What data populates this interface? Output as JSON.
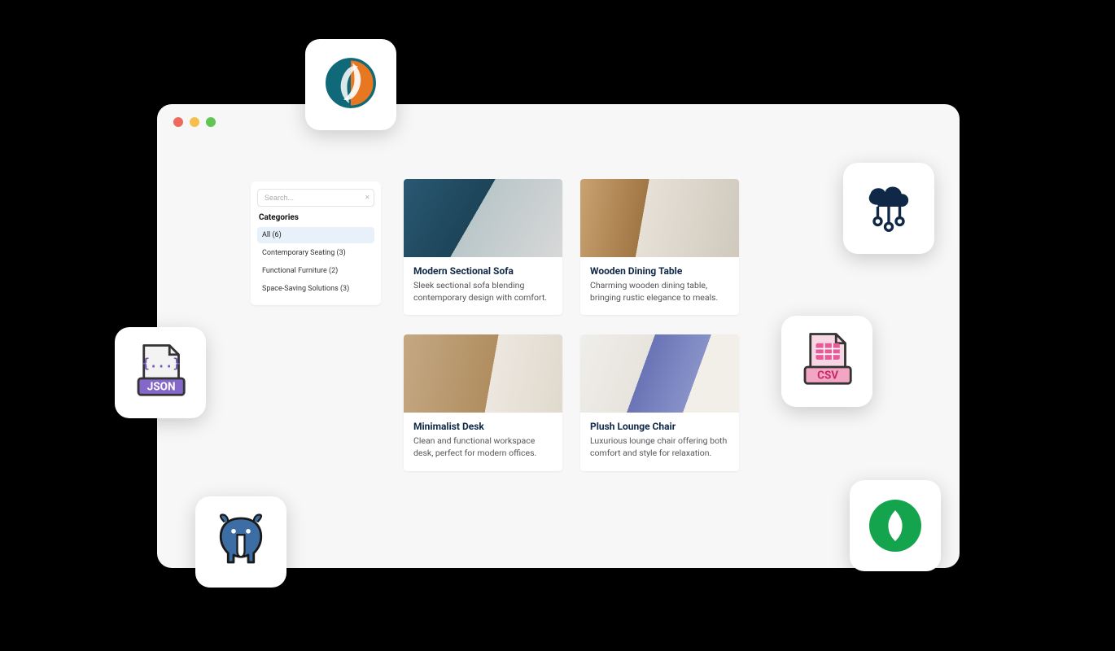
{
  "sidebar": {
    "search_placeholder": "Search...",
    "clear_icon": "×",
    "heading": "Categories",
    "items": [
      {
        "label": "All (6)",
        "active": true
      },
      {
        "label": "Contemporary Seating (3)",
        "active": false
      },
      {
        "label": "Functional Furniture (2)",
        "active": false
      },
      {
        "label": "Space-Saving Solutions (3)",
        "active": false
      }
    ]
  },
  "products": [
    {
      "title": "Modern Sectional Sofa",
      "desc": "Sleek sectional sofa blending contemporary design with comfort.",
      "img": "img-sofa"
    },
    {
      "title": "Wooden Dining Table",
      "desc": "Charming wooden dining table, bringing rustic elegance to meals.",
      "img": "img-table"
    },
    {
      "title": "Minimalist Desk",
      "desc": "Clean and functional workspace desk, perfect for modern offices.",
      "img": "img-desk"
    },
    {
      "title": "Plush Lounge Chair",
      "desc": "Luxurious lounge chair offering both comfort and style for relaxation.",
      "img": "img-chair"
    }
  ],
  "tiles": {
    "json_label": "JSON",
    "csv_label": "CSV"
  },
  "colors": {
    "window_bg": "#f7f7f7",
    "card_title": "#0f2847",
    "page_bg": "#000000"
  }
}
